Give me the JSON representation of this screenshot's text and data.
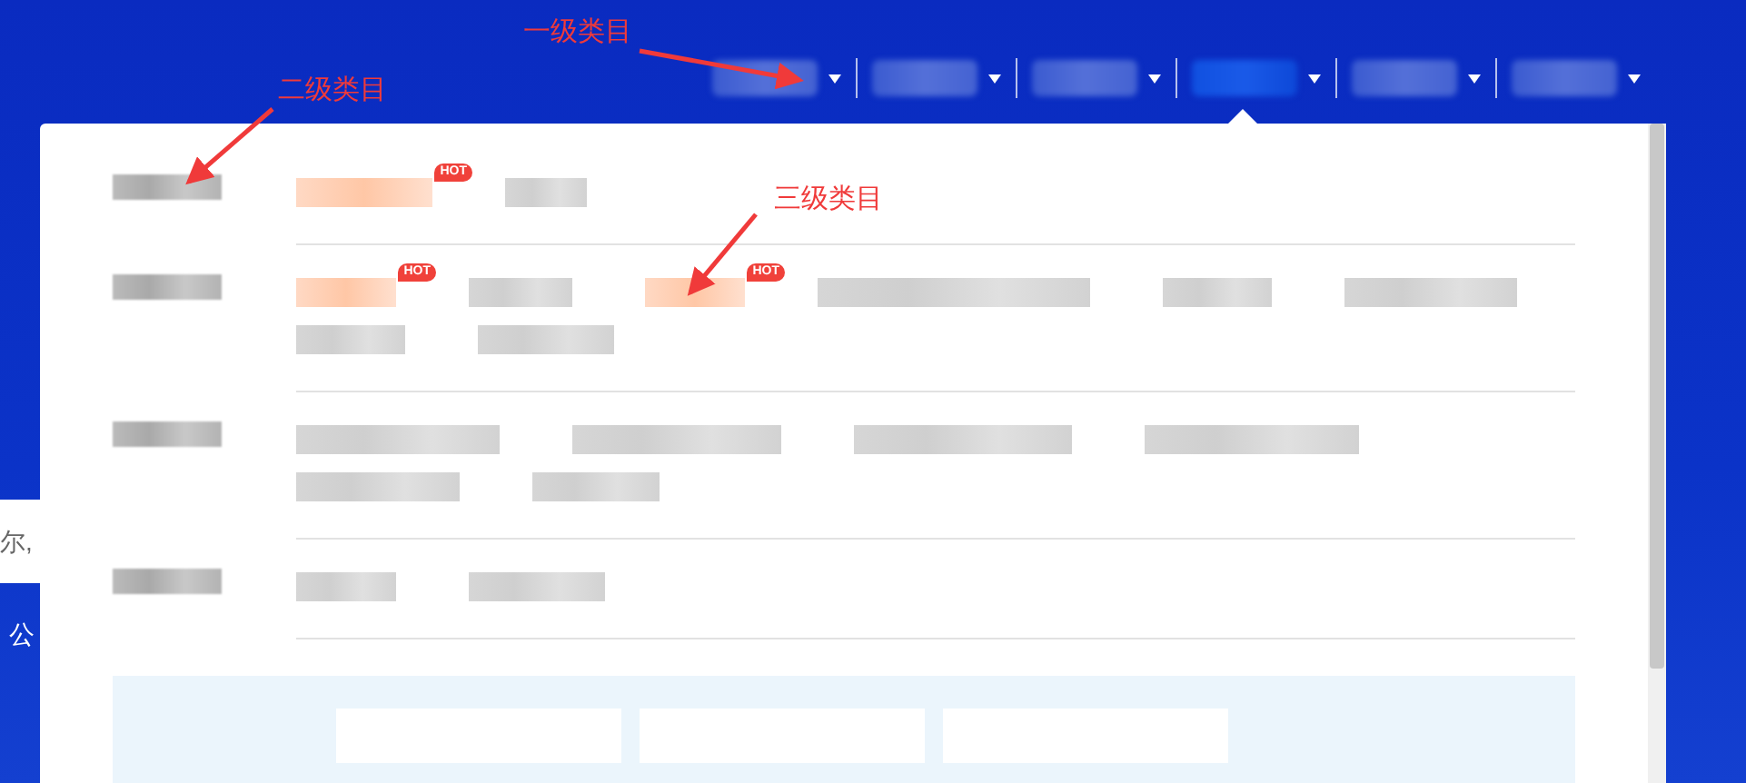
{
  "nav": {
    "items": [
      {
        "selected": false
      },
      {
        "selected": false
      },
      {
        "selected": false
      },
      {
        "selected": true
      },
      {
        "selected": false
      },
      {
        "selected": false
      }
    ]
  },
  "menu": {
    "rows": [
      {
        "items": [
          {
            "kind": "hot",
            "badge": "HOT"
          },
          {
            "kind": "plain"
          }
        ]
      },
      {
        "items": [
          {
            "kind": "hot",
            "badge": "HOT"
          },
          {
            "kind": "plain"
          },
          {
            "kind": "hot",
            "badge": "HOT"
          },
          {
            "kind": "plain"
          },
          {
            "kind": "plain"
          },
          {
            "kind": "plain"
          },
          {
            "kind": "plain"
          },
          {
            "kind": "plain"
          }
        ]
      },
      {
        "items": [
          {
            "kind": "plain"
          },
          {
            "kind": "plain"
          },
          {
            "kind": "plain"
          },
          {
            "kind": "plain"
          },
          {
            "kind": "plain"
          },
          {
            "kind": "plain"
          }
        ]
      },
      {
        "items": [
          {
            "kind": "plain"
          },
          {
            "kind": "plain"
          }
        ]
      }
    ]
  },
  "page_text": {
    "greeting": "尔,",
    "footer": "公"
  },
  "annotations": [
    {
      "text": "一级类目"
    },
    {
      "text": "二级类目"
    },
    {
      "text": "三级类目"
    }
  ]
}
